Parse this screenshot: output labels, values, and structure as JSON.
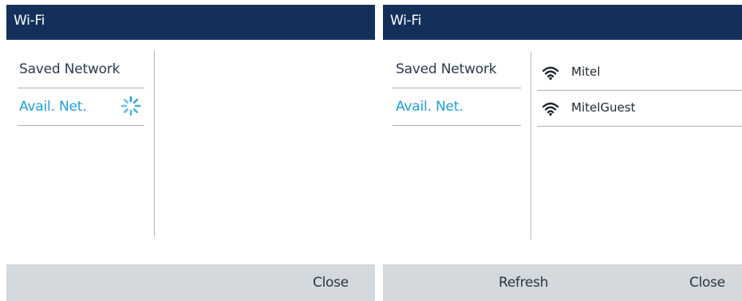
{
  "screens": {
    "left": {
      "title": "Wi-Fi",
      "menu": [
        {
          "label": "Saved Network"
        },
        {
          "label": "Avail. Net."
        }
      ],
      "softkeys": {
        "close_label": "Close"
      }
    },
    "right": {
      "title": "Wi-Fi",
      "menu": [
        {
          "label": "Saved Network"
        },
        {
          "label": "Avail. Net."
        }
      ],
      "networks": [
        {
          "name": "Mitel",
          "icon": "wifi-icon"
        },
        {
          "name": "MitelGuest",
          "icon": "wifi-icon"
        }
      ],
      "softkeys": {
        "refresh_label": "Refresh",
        "close_label": "Close"
      }
    }
  },
  "colors": {
    "title_bar": "#13305a",
    "accent": "#1e9fd9",
    "softkey_bar": "#d4d9dd"
  }
}
